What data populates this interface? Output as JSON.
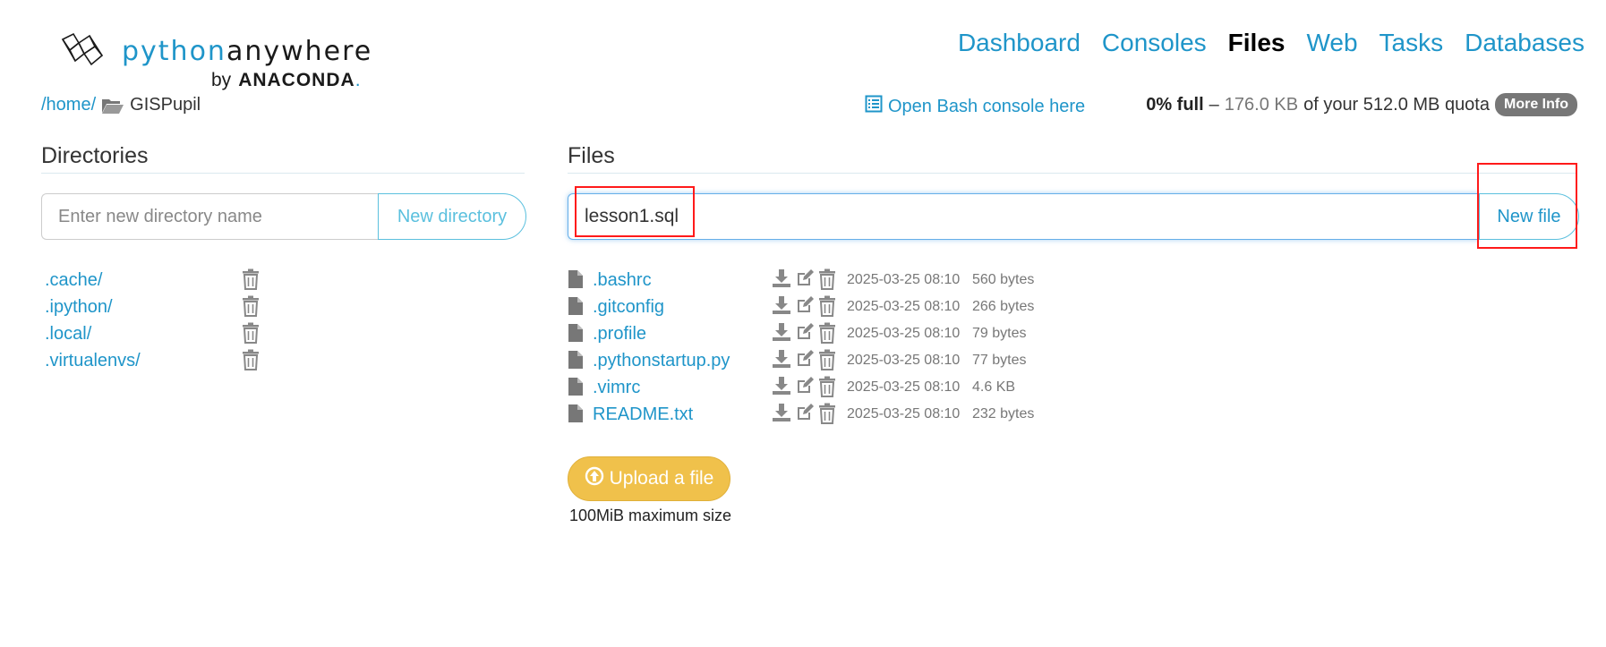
{
  "logo": {
    "python": "python",
    "anywhere": "anywhere",
    "by": "by",
    "brand": "ANACONDA",
    "dot": "."
  },
  "nav": {
    "items": [
      "Dashboard",
      "Consoles",
      "Files",
      "Web",
      "Tasks",
      "Databases"
    ],
    "active": "Files"
  },
  "breadcrumb": {
    "home": "/home/",
    "current": "GISPupil"
  },
  "bash_link": "Open Bash console here",
  "quota": {
    "percent": "0% full",
    "dash": "–",
    "used": "176.0 KB",
    "of_text": "of your 512.0 MB quota",
    "more_info": "More Info"
  },
  "directories": {
    "title": "Directories",
    "input_placeholder": "Enter new directory name",
    "button": "New directory",
    "items": [
      ".cache/",
      ".ipython/",
      ".local/",
      ".virtualenvs/"
    ]
  },
  "files": {
    "title": "Files",
    "input_value": "lesson1.sql",
    "button": "New file",
    "items": [
      {
        "name": ".bashrc",
        "date": "2025-03-25 08:10",
        "size": "560 bytes"
      },
      {
        "name": ".gitconfig",
        "date": "2025-03-25 08:10",
        "size": "266 bytes"
      },
      {
        "name": ".profile",
        "date": "2025-03-25 08:10",
        "size": "79 bytes"
      },
      {
        "name": ".pythonstartup.py",
        "date": "2025-03-25 08:10",
        "size": "77 bytes"
      },
      {
        "name": ".vimrc",
        "date": "2025-03-25 08:10",
        "size": "4.6 KB"
      },
      {
        "name": "README.txt",
        "date": "2025-03-25 08:10",
        "size": "232 bytes"
      }
    ],
    "upload_button": "Upload a file",
    "upload_note": "100MiB maximum size"
  },
  "colors": {
    "link": "#1f95c9",
    "upload": "#f0c14b",
    "highlight": "#ff1a1a",
    "badge": "#777777"
  }
}
